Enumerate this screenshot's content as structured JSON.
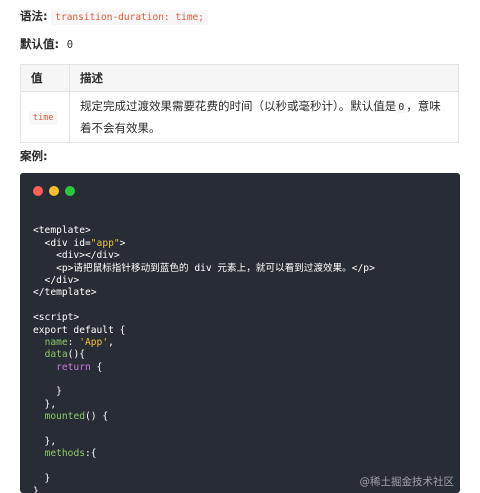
{
  "syntax": {
    "label": "语法:",
    "code": "transition-duration: time;"
  },
  "default": {
    "label": "默认值:",
    "value": "0"
  },
  "table": {
    "headers": [
      "值",
      "描述"
    ],
    "rows": [
      {
        "value": "time",
        "desc_main": "规定完成过渡效果需要花费的时间（以秒或毫秒计）。默认值是",
        "desc_code": "0",
        "desc_end": "，意味着不会有效果。"
      }
    ]
  },
  "example_label": "案例:",
  "window_dots": {
    "red": "#ff5f56",
    "yellow": "#ffbd2e",
    "green": "#27c93f"
  },
  "code_lines": [
    [],
    [
      {
        "t": "<template>",
        "c": "tag"
      }
    ],
    [
      {
        "t": "  <div id=",
        "c": "tag"
      },
      {
        "t": "\"app\"",
        "c": "str"
      },
      {
        "t": ">",
        "c": "tag"
      }
    ],
    [
      {
        "t": "    <div></div>",
        "c": "tag"
      }
    ],
    [
      {
        "t": "    <p>请把鼠标指针移动到蓝色的 div 元素上，就可以看到过渡效果。</p>",
        "c": "tag"
      }
    ],
    [
      {
        "t": "  </div>",
        "c": "tag"
      }
    ],
    [
      {
        "t": "</template>",
        "c": "tag"
      }
    ],
    [],
    [
      {
        "t": "<script>",
        "c": "tag"
      }
    ],
    [
      {
        "t": "export default {",
        "c": "tag"
      }
    ],
    [
      {
        "t": "  ",
        "c": "tag"
      },
      {
        "t": "name",
        "c": "prop"
      },
      {
        "t": ": ",
        "c": "tag"
      },
      {
        "t": "'App'",
        "c": "str"
      },
      {
        "t": ",",
        "c": "tag"
      }
    ],
    [
      {
        "t": "  ",
        "c": "tag"
      },
      {
        "t": "data",
        "c": "prop"
      },
      {
        "t": "(){",
        "c": "tag"
      }
    ],
    [
      {
        "t": "    ",
        "c": "tag"
      },
      {
        "t": "return",
        "c": "kw"
      },
      {
        "t": " {",
        "c": "tag"
      }
    ],
    [],
    [
      {
        "t": "    }",
        "c": "tag"
      }
    ],
    [
      {
        "t": "  },",
        "c": "tag"
      }
    ],
    [
      {
        "t": "  ",
        "c": "tag"
      },
      {
        "t": "mounted",
        "c": "prop"
      },
      {
        "t": "() {",
        "c": "tag"
      }
    ],
    [],
    [
      {
        "t": "  },",
        "c": "tag"
      }
    ],
    [
      {
        "t": "  ",
        "c": "tag"
      },
      {
        "t": "methods",
        "c": "prop"
      },
      {
        "t": ":{",
        "c": "tag"
      }
    ],
    [],
    [
      {
        "t": "  }",
        "c": "tag"
      }
    ],
    [
      {
        "t": "}",
        "c": "tag"
      }
    ]
  ],
  "watermark": "@稀土掘金技术社区"
}
